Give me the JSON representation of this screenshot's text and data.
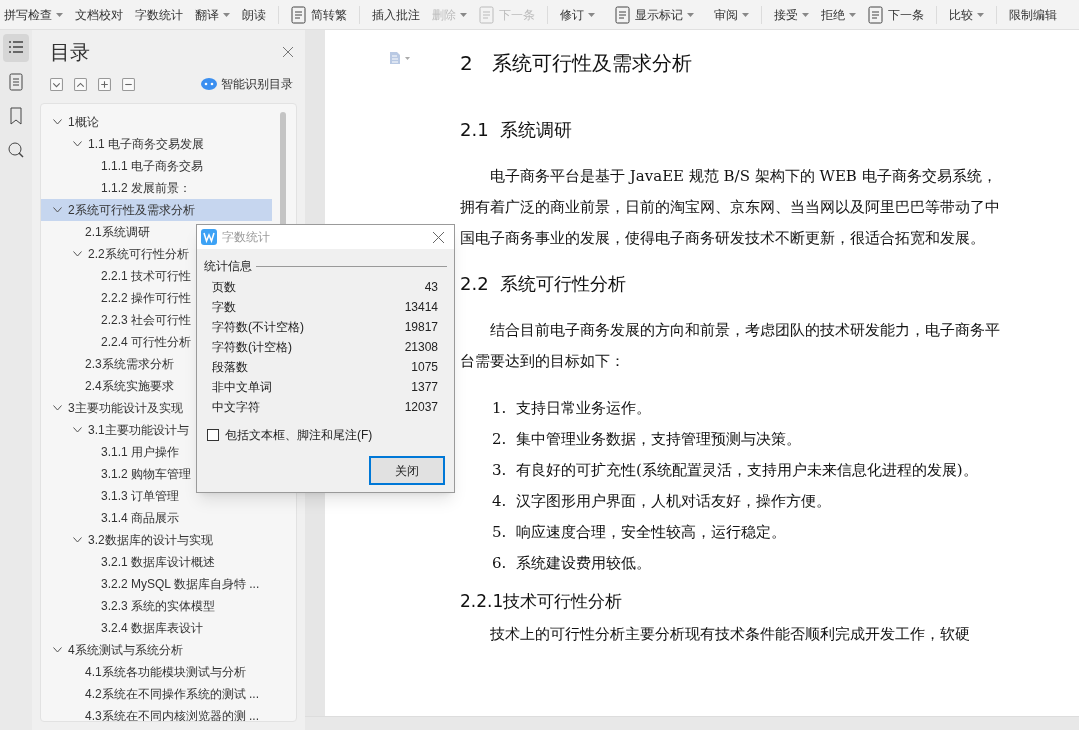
{
  "toolbar": {
    "groups": [
      [
        {
          "label": "拼写检查",
          "kind": "text",
          "dropdown": true,
          "disabled": false
        },
        {
          "label": "文档校对",
          "kind": "text",
          "dropdown": false,
          "disabled": false
        },
        {
          "label": "字数统计",
          "kind": "text",
          "dropdown": false,
          "disabled": false
        },
        {
          "label": "翻译",
          "kind": "text",
          "dropdown": true,
          "disabled": false
        },
        {
          "label": "朗读",
          "kind": "text",
          "dropdown": false,
          "disabled": false
        }
      ],
      [
        {
          "label": "简转繁",
          "kind": "icon",
          "dropdown": false,
          "disabled": false
        }
      ],
      [
        {
          "label": "插入批注",
          "kind": "text",
          "dropdown": false,
          "disabled": false
        },
        {
          "label": "删除",
          "kind": "text",
          "dropdown": true,
          "disabled": true
        },
        {
          "label": "下一条",
          "kind": "icon",
          "dropdown": false,
          "disabled": true
        }
      ],
      [
        {
          "label": "修订",
          "kind": "text",
          "dropdown": true,
          "disabled": false
        },
        {
          "label": "显示标记",
          "kind": "icon",
          "dropdown": true,
          "disabled": false
        },
        {
          "label": "审阅",
          "kind": "text",
          "dropdown": true,
          "disabled": false
        }
      ],
      [
        {
          "label": "接受",
          "kind": "text",
          "dropdown": true,
          "disabled": false
        },
        {
          "label": "拒绝",
          "kind": "text",
          "dropdown": true,
          "disabled": false
        },
        {
          "label": "下一条",
          "kind": "icon",
          "dropdown": false,
          "disabled": false
        }
      ],
      [
        {
          "label": "比较",
          "kind": "text",
          "dropdown": true,
          "disabled": false
        }
      ],
      [
        {
          "label": "限制编辑",
          "kind": "text",
          "dropdown": false,
          "disabled": false
        }
      ]
    ]
  },
  "side_tabs": [
    {
      "selected": true
    },
    {
      "selected": false
    },
    {
      "selected": false
    },
    {
      "selected": false
    }
  ],
  "toc": {
    "title": "目录",
    "smart_button": "智能识别目录",
    "items": [
      {
        "label": "1概论",
        "expanded": true,
        "selected": false,
        "children": [
          {
            "label": "1.1 电子商务交易发展",
            "expanded": true,
            "selected": false,
            "children": [
              {
                "label": "1.1.1 电子商务交易",
                "selected": false
              },
              {
                "label": "1.1.2 发展前景：",
                "selected": false
              }
            ]
          }
        ]
      },
      {
        "label": "2系统可行性及需求分析",
        "expanded": true,
        "selected": true,
        "children": [
          {
            "label": "2.1系统调研",
            "selected": false
          },
          {
            "label": "2.2系统可行性分析",
            "expanded": true,
            "selected": false,
            "children": [
              {
                "label": "2.2.1 技术可行性",
                "selected": false
              },
              {
                "label": "2.2.2  操作可行性",
                "selected": false
              },
              {
                "label": "2.2.3  社会可行性",
                "selected": false
              },
              {
                "label": "2.2.4 可行性分析",
                "selected": false
              }
            ]
          },
          {
            "label": "2.3系统需求分析",
            "selected": false
          },
          {
            "label": "2.4系统实施要求",
            "selected": false
          }
        ]
      },
      {
        "label": "3主要功能设计及实现",
        "expanded": true,
        "selected": false,
        "children": [
          {
            "label": "3.1主要功能设计与",
            "expanded": true,
            "selected": false,
            "children": [
              {
                "label": "3.1.1  用户操作",
                "selected": false
              },
              {
                "label": "3.1.2 购物车管理",
                "selected": false
              },
              {
                "label": "3.1.3 订单管理",
                "selected": false
              },
              {
                "label": "3.1.4 商品展示",
                "selected": false
              }
            ]
          },
          {
            "label": "3.2数据库的设计与实现",
            "expanded": true,
            "selected": false,
            "children": [
              {
                "label": "3.2.1 数据库设计概述",
                "selected": false
              },
              {
                "label": "3.2.2 MySQL 数据库自身特 ...",
                "selected": false
              },
              {
                "label": "3.2.3  系统的实体模型",
                "selected": false
              },
              {
                "label": "3.2.4 数据库表设计",
                "selected": false
              }
            ]
          }
        ]
      },
      {
        "label": "4系统测试与系统分析",
        "expanded": true,
        "selected": false,
        "children": [
          {
            "label": "4.1系统各功能模块测试与分析",
            "selected": false
          },
          {
            "label": "4.2系统在不同操作系统的测试 ...",
            "selected": false
          },
          {
            "label": "4.3系统在不同内核浏览器的测 ...",
            "selected": false
          }
        ]
      }
    ]
  },
  "document": {
    "blocks": [
      {
        "kind": "h1",
        "text": "2   系统可行性及需求分析"
      },
      {
        "kind": "h2",
        "text": "2.1  系统调研"
      },
      {
        "kind": "p",
        "text": "电子商务平台是基于 JavaEE 规范 B/S 架构下的 WEB 电子商务交易系统，拥有着广泛的商业前景，日前的淘宝网、京东网、当当网以及阿里巴巴等带动了中国电子商务事业的发展，使得电子商务研发技术不断更新，很适合拓宽和发展。"
      },
      {
        "kind": "h2",
        "text": "2.2  系统可行性分析"
      },
      {
        "kind": "p",
        "text": "结合目前电子商务发展的方向和前景，考虑团队的技术研发能力，电子商务平台需要达到的目标如下："
      },
      {
        "kind": "li",
        "number": "1.",
        "text": "支持日常业务运作。"
      },
      {
        "kind": "li",
        "number": "2.",
        "text": "集中管理业务数据，支持管理预测与决策。"
      },
      {
        "kind": "li",
        "number": "3.",
        "text": "有良好的可扩充性(系统配置灵活，支持用户未来信息化进程的发展)。"
      },
      {
        "kind": "li",
        "number": "4.",
        "text": "汉字图形用户界面，人机对话友好，操作方便。"
      },
      {
        "kind": "li",
        "number": "5.",
        "text": "响应速度合理，安全性较高，运行稳定。"
      },
      {
        "kind": "li",
        "number": "6.",
        "text": "系统建设费用较低。"
      },
      {
        "kind": "h3",
        "text": "2.2.1技术可行性分析"
      },
      {
        "kind": "p",
        "text": "技术上的可行性分析主要分析现有技术条件能否顺利完成开发工作，软硬"
      }
    ]
  },
  "dialog": {
    "title": "字数统计",
    "group": "统计信息",
    "rows": [
      {
        "label": "页数",
        "value": "43"
      },
      {
        "label": "字数",
        "value": "13414"
      },
      {
        "label": "字符数(不计空格)",
        "value": "19817"
      },
      {
        "label": "字符数(计空格)",
        "value": "21308"
      },
      {
        "label": "段落数",
        "value": "1075"
      },
      {
        "label": "非中文单词",
        "value": "1377"
      },
      {
        "label": "中文字符",
        "value": "12037"
      }
    ],
    "checkbox": {
      "label": "包括文本框、脚注和尾注(F)",
      "checked": false
    },
    "button": "关闭"
  }
}
